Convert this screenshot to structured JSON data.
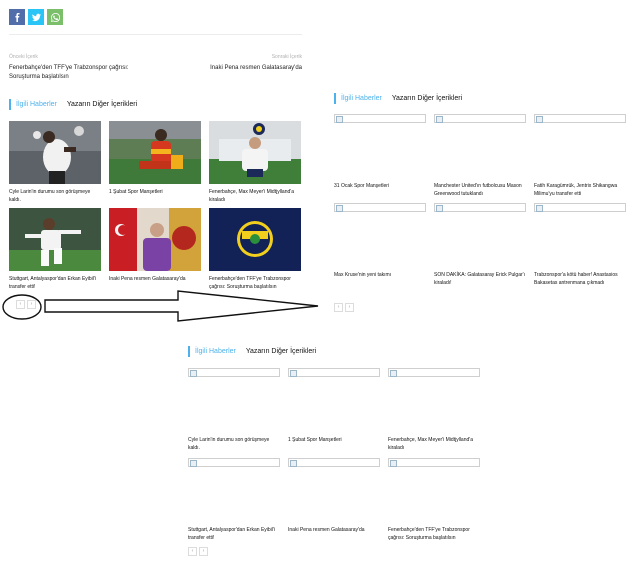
{
  "share": {
    "buttons": [
      {
        "name": "facebook-share-button",
        "icon": "facebook-icon"
      },
      {
        "name": "twitter-share-button",
        "icon": "twitter-icon"
      },
      {
        "name": "whatsapp-share-button",
        "icon": "whatsapp-icon"
      }
    ]
  },
  "article_nav": {
    "prev_label": "Önceki İçerik",
    "prev_title": "Fenerbahçe'den TFF'ye Trabzonspor çağrısı: Soruşturma başlatılsın",
    "next_label": "Sonraki İçerik",
    "next_title": "Inaki Pena resmen Galatasaray'da"
  },
  "related_top": {
    "tab_active": "İlgili Haberler",
    "tab_other": "Yazarın Diğer İçerikleri",
    "cards": [
      "Cyle Larin'in durumu son görüşmeye kaldı.",
      "1 Şubat Spor Manşetleri",
      "Fenerbahçe, Max Meyer'i Midtjylland'a kiraladı",
      "Stuttgart, Antalyaspor'dan Erkan Eyibil'i transfer etti!",
      "Inaki Pena resmen Galatasaray'da",
      "Fenerbahçe'den TFF'ye Trabzonspor çağrısı: Soruşturma başlatılsın"
    ]
  },
  "related_right": {
    "tab_active": "İlgili Haberler",
    "tab_other": "Yazarın Diğer İçerikleri",
    "cards": [
      "31 Ocak Spor Manşetleri",
      "Manchester United'ın futbolcusu Mason Greenwood tutuklandı",
      "Fatih Karagümrük, Jentrix Shikangwa Milimu'yu transfer etti",
      "Max Kruse'nin yeni takımı",
      "SON DAKİKA: Galatasaray Erick Pulgar'ı kiraladı!",
      "Trabzonspor'a kötü haber! Anastasios Bakasetas antrenmana çıkmadı"
    ]
  },
  "related_bottom": {
    "tab_active": "İlgili Haberler",
    "tab_other": "Yazarın Diğer İçerikleri",
    "cards": [
      "Cyle Larin'in durumu son görüşmeye kaldı.",
      "1 Şubat Spor Manşetleri",
      "Fenerbahçe, Max Meyer'i Midtjylland'a kiraladı",
      "Stuttgart, Antalyaspor'dan Erkan Eyibil'i transfer etti!",
      "Inaki Pena resmen Galatasaray'da",
      "Fenerbahçe'den TFF'ye Trabzonspor çağrısı: Soruşturma başlatılsın"
    ]
  },
  "pager": {
    "prev": "‹",
    "next": "›"
  },
  "colors": {
    "accent": "#4db2ec",
    "facebook": "#516eab",
    "twitter": "#29c5f6",
    "whatsapp": "#7bbf6a"
  }
}
